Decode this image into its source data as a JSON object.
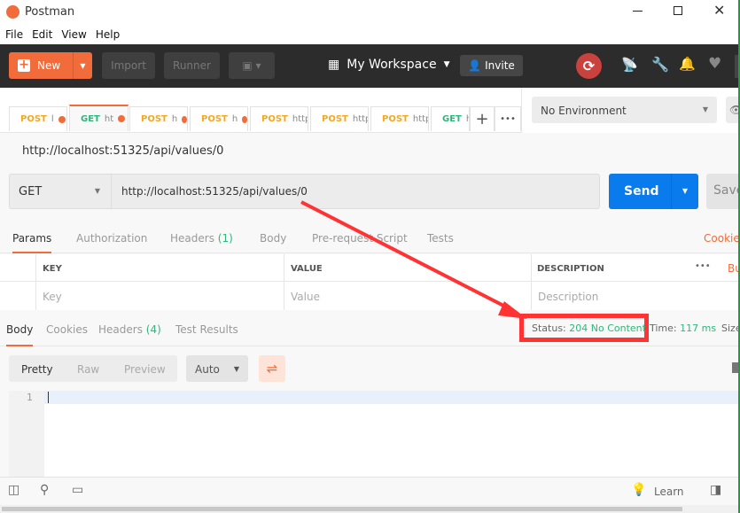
{
  "window": {
    "title": "Postman",
    "controls": [
      "minimize",
      "maximize",
      "close"
    ]
  },
  "menu": [
    "File",
    "Edit",
    "View",
    "Help"
  ],
  "toolbar": {
    "new": "New",
    "import": "Import",
    "runner": "Runner",
    "workspace": "My Workspace",
    "invite": "Invite"
  },
  "tabs": [
    {
      "method": "POST",
      "text": "l",
      "dot": true
    },
    {
      "method": "GET",
      "text": "ht",
      "dot": true,
      "active": true
    },
    {
      "method": "POST",
      "text": "h",
      "dot": true
    },
    {
      "method": "POST",
      "text": "h",
      "dot": true
    },
    {
      "method": "POST",
      "text": "http",
      "dot": false
    },
    {
      "method": "POST",
      "text": "http",
      "dot": false
    },
    {
      "method": "POST",
      "text": "http",
      "dot": false
    },
    {
      "method": "GET",
      "text": "ht",
      "dot": false
    }
  ],
  "environment": "No Environment",
  "request": {
    "title": "http://localhost:51325/api/values/0",
    "method": "GET",
    "url": "http://localhost:51325/api/values/0",
    "send": "Send",
    "save": "Save"
  },
  "request_tabs": {
    "params": "Params",
    "authorization": "Authorization",
    "headers": "Headers",
    "headers_count": "(1)",
    "body": "Body",
    "prerequest": "Pre-request Script",
    "tests": "Tests",
    "cookies": "Cookies"
  },
  "params_table": {
    "key": "KEY",
    "value": "VALUE",
    "description": "DESCRIPTION",
    "bulk": "Bu",
    "key_ph": "Key",
    "value_ph": "Value",
    "desc_ph": "Description"
  },
  "response_tabs": {
    "body": "Body",
    "cookies": "Cookies",
    "headers": "Headers",
    "headers_count": "(4)",
    "tests": "Test Results"
  },
  "status": {
    "label": "Status:",
    "value": "204 No Content",
    "time_label": "Time:",
    "time": "117 ms",
    "size_label": "Size"
  },
  "response_toolbar": {
    "pretty": "Pretty",
    "raw": "Raw",
    "preview": "Preview",
    "format": "Auto"
  },
  "editor": {
    "line": "1"
  },
  "footer": {
    "learn": "Learn"
  }
}
